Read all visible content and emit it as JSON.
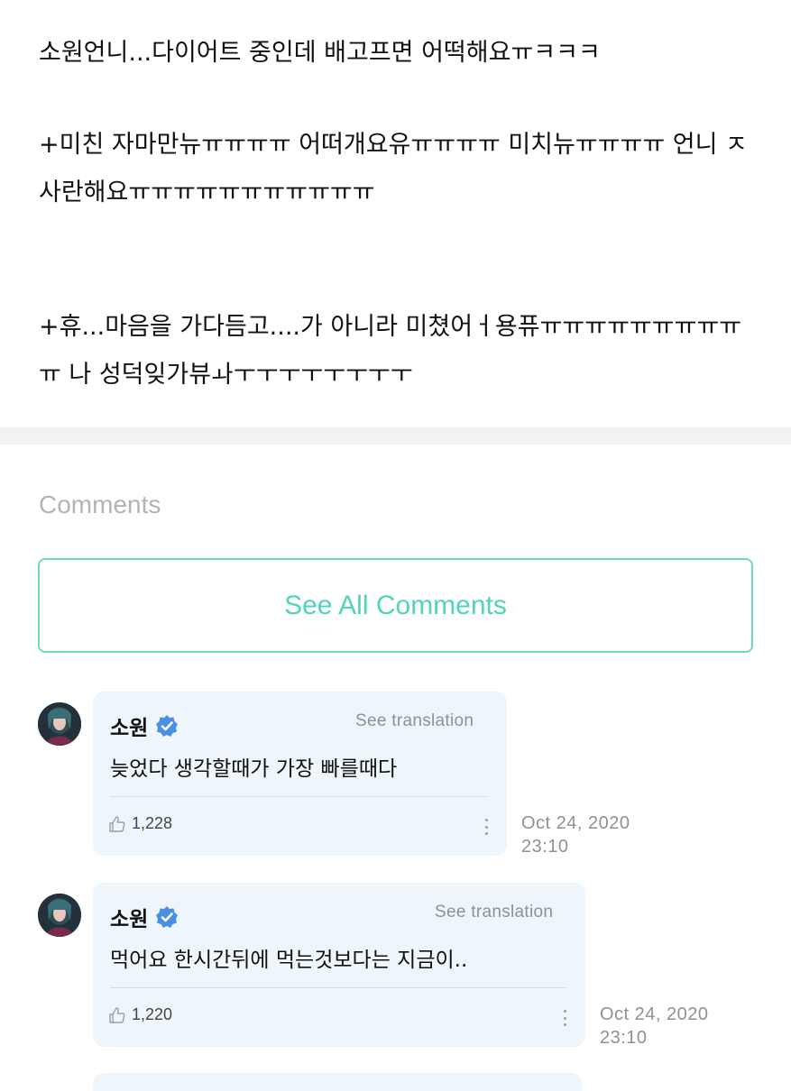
{
  "post": {
    "paragraphs": [
      "소원언니...다이어트 중인데 배고프면 어떡해요ㅠㅋㅋㅋ",
      "+미친 자마만뉴ㅠㅠㅠㅠ 어떠개요유ㅠㅠㅠㅠ 미치뉴ㅠㅠㅠㅠ 언니 ㅈ사란해요ㅠㅠㅠㅠㅠㅠㅠㅠㅠㅠㅠ",
      "+휴...마음을 가다듬고....가 아니라 미쳤어ㅓ용퓨ㅠㅠㅠㅠㅠㅠㅠㅠㅠㅠ 나 성덕잊가뷰ㅘㅜㅜㅜㅜㅜㅜㅜㅜ"
    ]
  },
  "comments_section": {
    "heading": "Comments",
    "see_all_label": "See All Comments"
  },
  "comments": [
    {
      "author": "소원",
      "verified_icon": "verified-badge-icon",
      "see_translation": "See translation",
      "text": "늦었다 생각할때가 가장 빠를때다",
      "likes": "1,228",
      "date": "Oct 24, 2020",
      "time": "23:10"
    },
    {
      "author": "소원",
      "verified_icon": "verified-badge-icon",
      "see_translation": "See translation",
      "text": "먹어요 한시간뒤에 먹는것보다는 지금이..",
      "likes": "1,220",
      "date": "Oct 24, 2020",
      "time": "23:10"
    }
  ],
  "colors": {
    "accent": "#52d4b6",
    "bubble": "#eef6fb",
    "verified": "#4a90e2",
    "muted": "#8e9197"
  }
}
